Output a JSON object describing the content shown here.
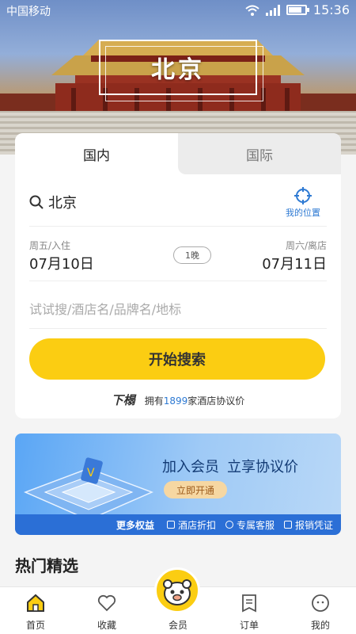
{
  "status_bar": {
    "carrier": "中国移动",
    "time": "15:36"
  },
  "hero": {
    "city_title": "北京"
  },
  "search": {
    "tabs": [
      {
        "label": "国内"
      },
      {
        "label": "国际"
      }
    ],
    "city": "北京",
    "location_label": "我的位置",
    "checkin": {
      "label": "周五/入住",
      "date": "07月10日"
    },
    "checkout": {
      "label": "周六/离店",
      "date": "07月11日"
    },
    "nights": "1晚",
    "keyword_placeholder": "试试搜/酒店名/品牌名/地标",
    "search_button": "开始搜索",
    "note": {
      "brand": "下榻",
      "prefix": "拥有",
      "count": "1899",
      "suffix": "家酒店协议价"
    }
  },
  "banner": {
    "title_a": "加入会员",
    "title_b": "立享协议价",
    "cta": "立即开通",
    "more": "更多权益",
    "benefits": [
      {
        "label": "酒店折扣"
      },
      {
        "label": "专属客服"
      },
      {
        "label": "报销凭证"
      }
    ]
  },
  "section_title": "热门精选",
  "nav": [
    {
      "label": "首页",
      "icon": "home-icon"
    },
    {
      "label": "收藏",
      "icon": "heart-icon"
    },
    {
      "label": "会员",
      "icon": "mascot-icon"
    },
    {
      "label": "订单",
      "icon": "order-icon"
    },
    {
      "label": "我的",
      "icon": "profile-icon"
    }
  ],
  "colors": {
    "accent": "#fbcd12",
    "link": "#2e7ad3",
    "banner": "#2b6fd6"
  }
}
